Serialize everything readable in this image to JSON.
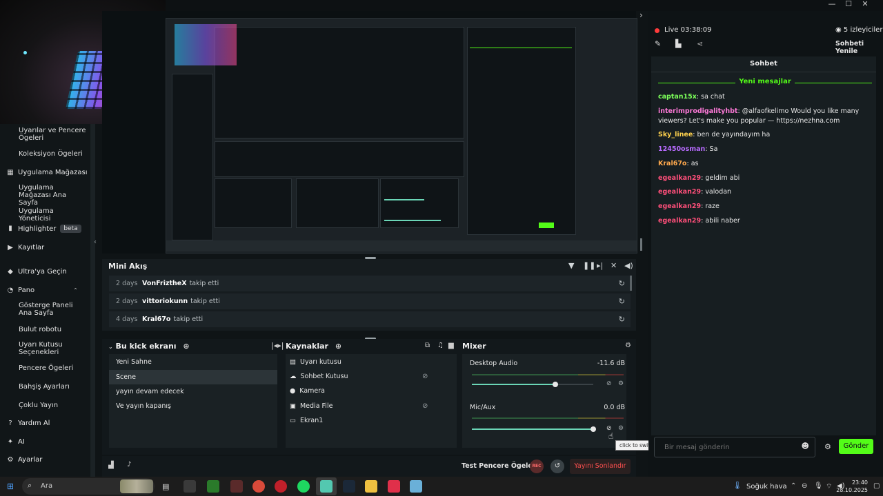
{
  "window": {
    "minimize": "—",
    "maximize": "☐",
    "close": "✕",
    "expand_chevron": "›"
  },
  "sidebar": {
    "items": [
      {
        "label": "Uyarılar ve Pencere Ögeleri",
        "type": "sub"
      },
      {
        "label": "Koleksiyon Ögeleri",
        "type": "sub"
      },
      {
        "label": "Uygulama Mağazası",
        "type": "section",
        "icon": "store-icon"
      },
      {
        "label": "Uygulama Mağazası Ana Sayfa",
        "type": "sub"
      },
      {
        "label": "Uygulama Yöneticisi",
        "type": "sub"
      },
      {
        "label": "Highlighter",
        "type": "section",
        "icon": "highlighter-icon",
        "badge": "beta"
      },
      {
        "label": "Kayıtlar",
        "type": "section",
        "icon": "play-icon"
      },
      {
        "label": "Ultra'ya Geçin",
        "type": "section",
        "icon": "ultra-icon"
      },
      {
        "label": "Pano",
        "type": "section",
        "icon": "dashboard-icon"
      },
      {
        "label": "Gösterge Paneli Ana Sayfa",
        "type": "sub"
      },
      {
        "label": "Bulut robotu",
        "type": "sub"
      },
      {
        "label": "Uyarı Kutusu Seçenekleri",
        "type": "sub"
      },
      {
        "label": "Pencere Ögeleri",
        "type": "sub"
      },
      {
        "label": "Bahşiş Ayarları",
        "type": "sub"
      },
      {
        "label": "Çoklu Yayın",
        "type": "sub"
      },
      {
        "label": "Yardım Al",
        "type": "section",
        "icon": "help-icon"
      },
      {
        "label": "AI",
        "type": "section",
        "icon": "ai-icon"
      },
      {
        "label": "Ayarlar",
        "type": "section",
        "icon": "settings-icon"
      }
    ]
  },
  "minifeed": {
    "title": "Mini Akış",
    "rows": [
      {
        "ago": "2 days",
        "user": "VonFriztheX",
        "action": "takip etti"
      },
      {
        "ago": "2 days",
        "user": "vittoriokunn",
        "action": "takip etti"
      },
      {
        "ago": "4 days",
        "user": "Kral67o",
        "action": "takip etti"
      }
    ]
  },
  "scenes": {
    "title": "Bu kick ekranı",
    "items": [
      "Yeni Sahne",
      "Scene",
      "yayın devam edecek",
      "Ve yayın kapanış"
    ],
    "selected_index": 1
  },
  "sources": {
    "title": "Kaynaklar",
    "items": [
      {
        "label": "Uyarı kutusu",
        "icon": "alertbox-icon",
        "hidden": false
      },
      {
        "label": "Sohbet Kutusu",
        "icon": "chat-source-icon",
        "hidden": true
      },
      {
        "label": "Kamera",
        "icon": "camera-icon",
        "hidden": false
      },
      {
        "label": "Media File",
        "icon": "media-icon",
        "hidden": true
      },
      {
        "label": "Ekran1",
        "icon": "monitor-icon",
        "hidden": false
      }
    ]
  },
  "mixer": {
    "title": "Mixer",
    "channels": [
      {
        "name": "Desktop Audio",
        "db": "-11.6 dB",
        "level": 0.69
      },
      {
        "name": "Mic/Aux",
        "db": "0.0 dB",
        "level": 1.0
      }
    ],
    "tooltip": "click to switch on"
  },
  "footer": {
    "test_label": "Test Pencere Ögeleri",
    "rec_label": "REC",
    "end_stream_label": "Yayını Sonlandır"
  },
  "chat": {
    "live_label": "Live",
    "live_time": "03:38:09",
    "viewers": "5 izleyiciler",
    "refresh_label": "Sohbeti Yenile",
    "header": "Sohbet",
    "new_messages_label": "Yeni mesajlar",
    "messages": [
      {
        "user": "captan15x",
        "text": "sa chat",
        "color": "#7cff5a"
      },
      {
        "user": "interimprodigalityhbt",
        "text": "@alfaofkelimo Would you like many viewers? Let's make you popular — https://nezhna.com",
        "color": "#ff7ad9"
      },
      {
        "user": "Sky_linee",
        "text": "ben de yayındayım ha",
        "color": "#ffd24d"
      },
      {
        "user": "12450osman",
        "text": "Sa",
        "color": "#b86bff"
      },
      {
        "user": "Kral67o",
        "text": "as",
        "color": "#ffa94d"
      },
      {
        "user": "egealkan29",
        "text": "geldim abi",
        "color": "#ff4f7a"
      },
      {
        "user": "egealkan29",
        "text": "valodan",
        "color": "#ff4f7a"
      },
      {
        "user": "egealkan29",
        "text": "raze",
        "color": "#ff4f7a"
      },
      {
        "user": "egealkan29",
        "text": "abili naber",
        "color": "#ff4f7a"
      }
    ],
    "input_placeholder": "Bir mesaj gönderin",
    "send_label": "Gönder"
  },
  "taskbar": {
    "search_placeholder": "Ara",
    "weather": "Soğuk hava",
    "time": "23:40",
    "date": "28.10.2025"
  },
  "colors": {
    "accent": "#53fc18",
    "teal": "#6bd6b7",
    "danger": "#ff4f4f"
  }
}
